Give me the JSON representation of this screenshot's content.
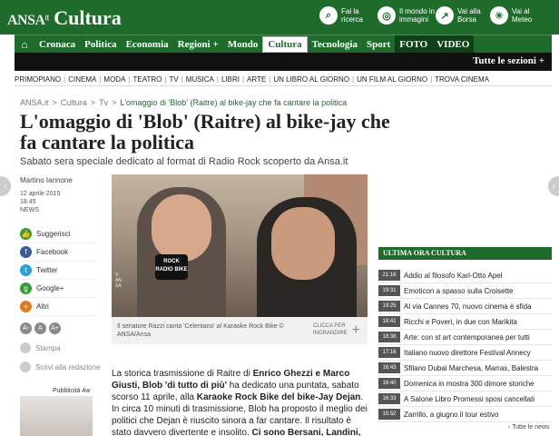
{
  "brand": {
    "ansa": "ANSA",
    "it": "it",
    "section": "Cultura"
  },
  "quick_links": [
    {
      "icon": "search-icon",
      "glyph": "⌕",
      "label": "Fai la ricerca"
    },
    {
      "icon": "world-icon",
      "glyph": "◎",
      "label": "Il mondo in immagini"
    },
    {
      "icon": "chart-icon",
      "glyph": "↗",
      "label": "Vai alla Borsa"
    },
    {
      "icon": "weather-icon",
      "glyph": "☀",
      "label": "Vai al Meteo"
    }
  ],
  "nav": {
    "home_glyph": "⌂",
    "items": [
      "Cronaca",
      "Politica",
      "Economia",
      "Regioni +",
      "Mondo",
      "Cultura",
      "Tecnologia",
      "Sport",
      "FOTO",
      "VIDEO"
    ]
  },
  "subbar": {
    "all_sections": "Tutte le sezioni +"
  },
  "sections": [
    "PRIMOPIANO",
    "CINEMA",
    "MODA",
    "TEATRO",
    "TV",
    "MUSICA",
    "LIBRI",
    "ARTE",
    "UN LIBRO AL GIORNO",
    "UN FILM AL GIORNO",
    "TROVA CINEMA"
  ],
  "breadcrumb": [
    "ANSA.it",
    ">",
    "Cultura",
    ">",
    "Tv",
    ">",
    "L'omaggio di 'Blob' (Raitre) al bike-jay che fa cantare la politica"
  ],
  "article": {
    "title": "L'omaggio di 'Blob' (Raitre) al bike-jay che fa cantare la politica",
    "subtitle": "Sabato sera speciale dedicato al format di Radio Rock scoperto da Ansa.it",
    "author": "Martino Iannone",
    "date": "12 aprile 2015",
    "time": "18:45",
    "category": "NEWS",
    "photo_credit": "© ANSA",
    "mic_label": "ROCK RADIO BIKE",
    "caption": "Il senatore Razzi canta 'Celentano' al Karaoke Rock Bike © ANSA/Ansa",
    "zoom_label": "CLICCA PER INGRANDIRE",
    "zoom_plus": "+",
    "body_parts": [
      {
        "t": "La storica trasmissione di Raitre di ",
        "b": false
      },
      {
        "t": "Enrico Ghezzi e Marco Giusti, Blob 'di tutto di più'",
        "b": true
      },
      {
        "t": " ha dedicato una puntata, sabato scorso 11 aprile, alla ",
        "b": false
      },
      {
        "t": "Karaoke Rock Bike del bike-Jay Dejan",
        "b": true
      },
      {
        "t": ". In circa 10 minuti di trasmissione, Blob ha proposto il meglio dei politici che Dejan è riuscito sinora a far cantare. Il risultato è stato davvero divertente e insolito. ",
        "b": false
      },
      {
        "t": "Ci sono Bersani, Landini, Verdini, Vendola, Orfini,",
        "b": true
      }
    ]
  },
  "share": [
    {
      "icon": "thumbs-up-icon",
      "label": "Suggerisci",
      "color": "#3a9a3a",
      "glyph": "👍"
    },
    {
      "icon": "facebook-icon",
      "label": "Facebook",
      "color": "#3b5998",
      "glyph": "f"
    },
    {
      "icon": "twitter-icon",
      "label": "Twitter",
      "color": "#2aa3d8",
      "glyph": "t"
    },
    {
      "icon": "google-plus-icon",
      "label": "Google+",
      "color": "#3a9a3a",
      "glyph": "g"
    },
    {
      "icon": "plus-icon",
      "label": "Altri",
      "color": "#e07a20",
      "glyph": "+"
    }
  ],
  "font_sizes": [
    "A-",
    "A",
    "A+"
  ],
  "tools": {
    "print": "Stampa",
    "write": "Scrivi alla redazione"
  },
  "promo": "Pubblicità 4w",
  "sidebar": {
    "title": "ULTIMA ORA CULTURA",
    "items": [
      {
        "time": "21:16",
        "text": "Addio al filosofo Karl-Otto Apel"
      },
      {
        "time": "19:31",
        "text": "Emoticon a spasso sulla Croisette"
      },
      {
        "time": "19:25",
        "text": "Al via Cannes 70, nuovo cinema è sfida"
      },
      {
        "time": "18:41",
        "text": "Ricchi e Poveri, in due con Marikita"
      },
      {
        "time": "18:38",
        "text": "Arte: con st art contemporanea per tutti"
      },
      {
        "time": "17:16",
        "text": "Italiano nuovo direttore Festival Annecy"
      },
      {
        "time": "16:43",
        "text": "Sfilano Dubai Marchesa, Marras, Balestra"
      },
      {
        "time": "16:40",
        "text": "Domenica in mostra 300 dimore storiche"
      },
      {
        "time": "16:33",
        "text": "A Salone Libro Promessi sposi cancellati"
      },
      {
        "time": "15:52",
        "text": "Zarrillo, a giugno il tour estivo"
      }
    ],
    "more": "› Tutte le news"
  },
  "arrows": {
    "left": "‹",
    "right": "›"
  },
  "colors": {
    "brand_green": "#1f6b2c",
    "dark_bar": "#111111"
  }
}
